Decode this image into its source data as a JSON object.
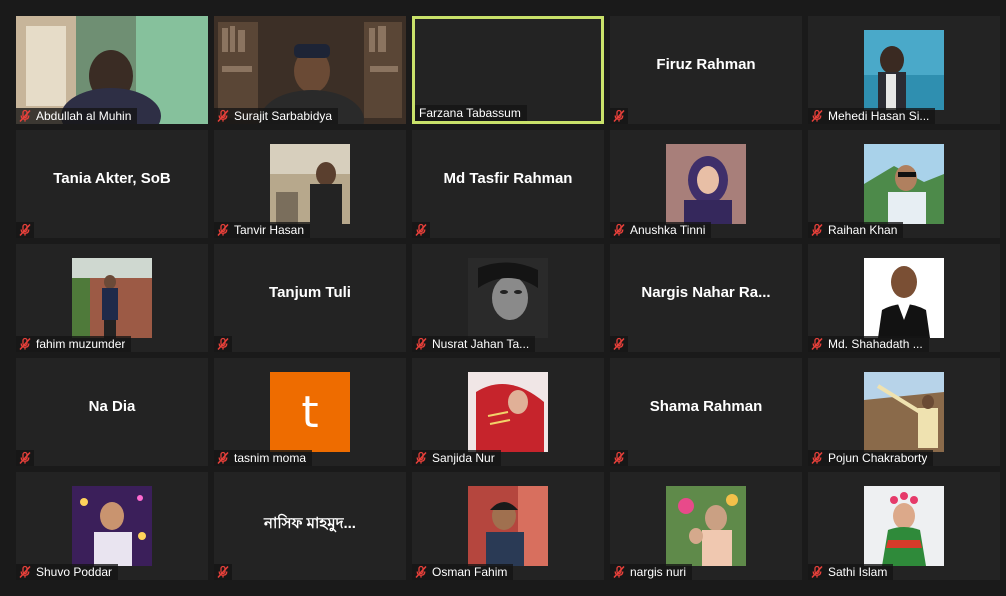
{
  "participants": [
    {
      "name": "Abdullah al Muhin",
      "mode": "video",
      "scene": "room-green"
    },
    {
      "name": "Surajit Sarbabidya",
      "mode": "video",
      "scene": "bookshelf"
    },
    {
      "name": "Farzana Tabassum",
      "mode": "blank",
      "active": true
    },
    {
      "name": "Firuz Rahman",
      "mode": "text"
    },
    {
      "name": "Mehedi Hasan Si...",
      "mode": "photo",
      "scene": "sea"
    },
    {
      "name": "Tania Akter, SoB",
      "mode": "text"
    },
    {
      "name": "Tanvir Hasan",
      "mode": "photo",
      "scene": "outdoor-wall"
    },
    {
      "name": "Md Tasfir Rahman",
      "mode": "text"
    },
    {
      "name": "Anushka Tinni",
      "mode": "photo",
      "scene": "hijab"
    },
    {
      "name": "Raihan Khan",
      "mode": "photo",
      "scene": "hills"
    },
    {
      "name": "fahim muzumder",
      "mode": "photo",
      "scene": "brick"
    },
    {
      "name": "Tanjum Tuli",
      "mode": "text"
    },
    {
      "name": "Nusrat Jahan Ta...",
      "mode": "photo",
      "scene": "bw"
    },
    {
      "name": "Nargis Nahar Ra...",
      "mode": "text"
    },
    {
      "name": "Md. Shahadath ...",
      "mode": "photo",
      "scene": "portrait-white"
    },
    {
      "name": "Na Dia",
      "mode": "text"
    },
    {
      "name": "tasnim moma",
      "mode": "letter",
      "letter": "t"
    },
    {
      "name": "Sanjida Nur",
      "mode": "photo",
      "scene": "red-saree"
    },
    {
      "name": "Shama Rahman",
      "mode": "text"
    },
    {
      "name": "Pojun Chakraborty",
      "mode": "photo",
      "scene": "sky-field"
    },
    {
      "name": "Shuvo Poddar",
      "mode": "photo",
      "scene": "purple-lights"
    },
    {
      "name": "নাসিফ মাহমুদ...",
      "mode": "text"
    },
    {
      "name": "Osman Fahim",
      "mode": "photo",
      "scene": "red-building"
    },
    {
      "name": "nargis nuri",
      "mode": "photo",
      "scene": "garden"
    },
    {
      "name": "Sathi Islam",
      "mode": "photo",
      "scene": "flowers"
    }
  ],
  "colors": {
    "active_border": "#c9e16a",
    "mic_muted": "#e8403a",
    "letter_bg": "#ee6c00"
  },
  "icons": {
    "muted_mic": "mic-muted-icon"
  }
}
